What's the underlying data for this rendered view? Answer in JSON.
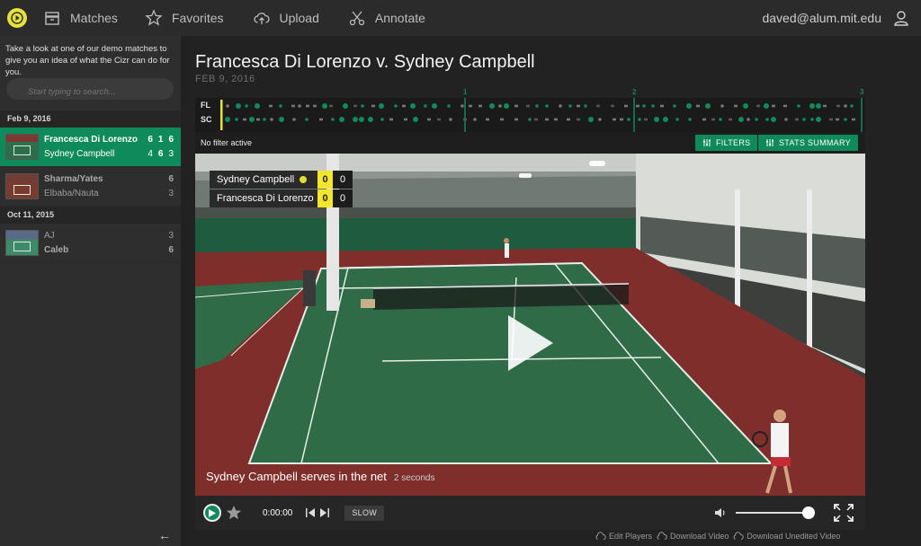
{
  "nav": {
    "matches": "Matches",
    "favorites": "Favorites",
    "upload": "Upload",
    "annotate": "Annotate",
    "user_email": "daved@alum.mit.edu"
  },
  "sidebar": {
    "intro": "Take a look at one of our demo matches to give you an idea of what the Cizr can do for you.",
    "search_placeholder": "Start typing to search...",
    "groups": [
      {
        "date": "Feb 9, 2016",
        "matches": [
          {
            "player1": "Francesca Di Lorenzo",
            "p1_sets": [
              "6",
              "1",
              "6"
            ],
            "player2": "Sydney Campbell",
            "p2_sets": [
              "4",
              "6",
              "3"
            ],
            "active": true
          },
          {
            "player1": "Sharma/Yates",
            "p1_sets": [
              "6"
            ],
            "player2": "Elbaba/Nauta",
            "p2_sets": [
              "3"
            ],
            "active": false
          }
        ]
      },
      {
        "date": "Oct 11, 2015",
        "matches": [
          {
            "player1": "AJ",
            "p1_sets": [
              "3"
            ],
            "player2": "Caleb",
            "p2_sets": [
              "6"
            ],
            "active": false
          }
        ]
      }
    ]
  },
  "match": {
    "title": "Francesca Di Lorenzo v. Sydney Campbell",
    "date": "FEB 9, 2016"
  },
  "timeline": {
    "row1_label": "FL",
    "row2_label": "SC",
    "set_markers": [
      "1",
      "2",
      "3"
    ],
    "accent_color": "#e7e23a",
    "point_color": "#0f8a5a"
  },
  "filter": {
    "status": "No filter active",
    "filters_label": "FILTERS",
    "stats_label": "STATS SUMMARY"
  },
  "scoreboard": {
    "server": {
      "name": "Sydney Campbell",
      "games": "0",
      "points": "0"
    },
    "receiver": {
      "name": "Francesca Di Lorenzo",
      "games": "0",
      "points": "0"
    }
  },
  "caption": {
    "text": "Sydney Campbell serves in the net",
    "duration": "2 seconds"
  },
  "controls": {
    "time": "0:00:00",
    "slow_label": "SLOW",
    "volume": 0.92
  },
  "footer": {
    "edit_players": "Edit Players",
    "download_video": "Download Video",
    "download_unedited": "Download Unedited Video"
  },
  "colors": {
    "brand_green": "#0f8a5a",
    "brand_yellow": "#e7e23a",
    "background": "#232323"
  }
}
